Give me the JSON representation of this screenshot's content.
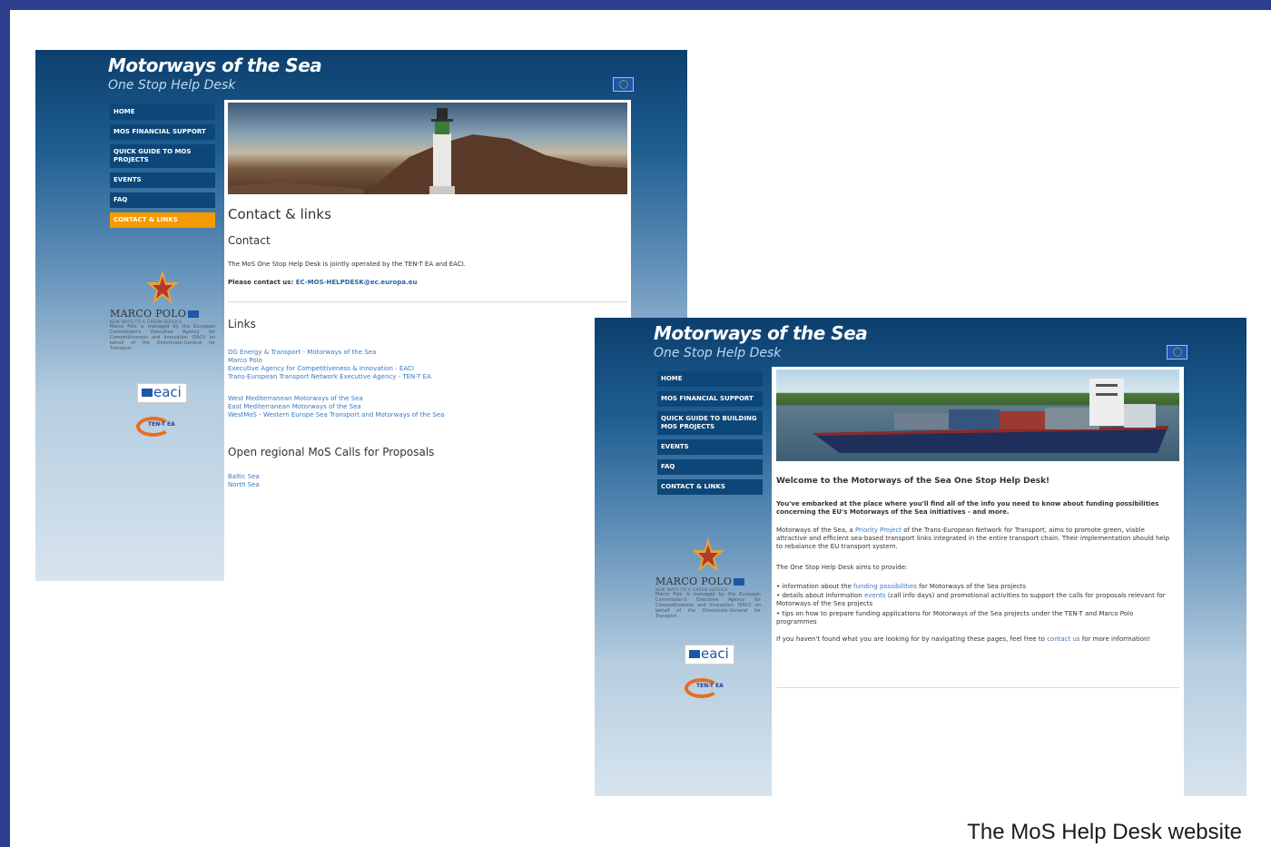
{
  "caption": "The MoS Help Desk website",
  "site": {
    "title": "Motorways of the Sea",
    "subtitle": "One Stop Help Desk"
  },
  "shot_contact": {
    "nav": [
      {
        "label": "HOME"
      },
      {
        "label": "MOS FINANCIAL SUPPORT"
      },
      {
        "label": "QUICK GUIDE TO MOS PROJECTS"
      },
      {
        "label": "EVENTS"
      },
      {
        "label": "FAQ"
      },
      {
        "label": "CONTACT & LINKS",
        "active": true
      }
    ],
    "heading": "Contact & links",
    "contact_heading": "Contact",
    "contact_text": "The MoS One Stop Help Desk is jointly operated by the TEN-T EA and EACI.",
    "contact_label": "Please contact us:",
    "contact_email": "EC-MOS-HELPDESK@ec.europa.eu",
    "links_heading": "Links",
    "links_group1": [
      "DG Energy & Transport - Motorways of the Sea",
      "Marco Polo",
      "Executive Agency for Competitiveness & Innovation - EACI",
      "Trans-European Transport Network Executive Agency - TEN-T EA"
    ],
    "links_group2": [
      "West Mediterranean Motorways of the Sea",
      "East Mediterranean Motorways of the Sea",
      "WestMoS - Western Europe Sea Transport and Motorways of the Sea"
    ],
    "calls_heading": "Open regional MoS Calls for Proposals",
    "calls_links": [
      "Baltic Sea",
      "North Sea"
    ]
  },
  "shot_home": {
    "nav": [
      {
        "label": "HOME"
      },
      {
        "label": "MOS FINANCIAL SUPPORT"
      },
      {
        "label": "QUICK GUIDE TO BUILDING MOS PROJECTS"
      },
      {
        "label": "EVENTS"
      },
      {
        "label": "FAQ"
      },
      {
        "label": "CONTACT & LINKS"
      }
    ],
    "welcome": "Welcome to the Motorways of the Sea One Stop Help Desk!",
    "intro": "You've embarked at the place where you'll find all of the info you need to know about funding possibilities concerning the EU's Motorways of the Sea initiatives - and more.",
    "para1_a": "Motorways of the Sea, a ",
    "para1_link": "Priority Project",
    "para1_b": " of the Trans-European Network for Transport, aims to promote green, viable attractive and efficient sea-based transport links integrated in the entire transport chain. Their implementation should help to rebalance the EU transport system.",
    "para2": "The One Stop Help Desk aims to provide:",
    "bullet1_a": "• information about the ",
    "bullet1_link": "funding possibilities",
    "bullet1_b": " for Motorways of the Sea projects",
    "bullet2_a": "• details about information ",
    "bullet2_link": "events",
    "bullet2_b": " (call info days) and promotional activities to support the calls for proposals relevant for Motorways of the Sea projects",
    "bullet3": "• tips on how to prepare funding applications for Motorways of the Sea projects under the TEN-T and Marco Polo programmes",
    "para3_a": "If you haven't found what you are looking for by navigating these pages, feel free to ",
    "para3_link": "contact us",
    "para3_b": " for more information!"
  },
  "logos": {
    "marco_polo": "MARCO POLO",
    "marco_polo_tag": "NEW WAYS TO A GREEN SERVICE",
    "marco_polo_desc": "Marco Polo is managed by the European Commission's Executive Agency for Competitiveness and Innovation (EACI) on behalf of the Directorate-General for Transport.",
    "eaci": "eaci",
    "tent": "TEN-T EA"
  },
  "colors": {
    "frame": "#2d3f8c",
    "nav": "#0d4678",
    "nav_active": "#f59a00",
    "link": "#3a78c0"
  }
}
